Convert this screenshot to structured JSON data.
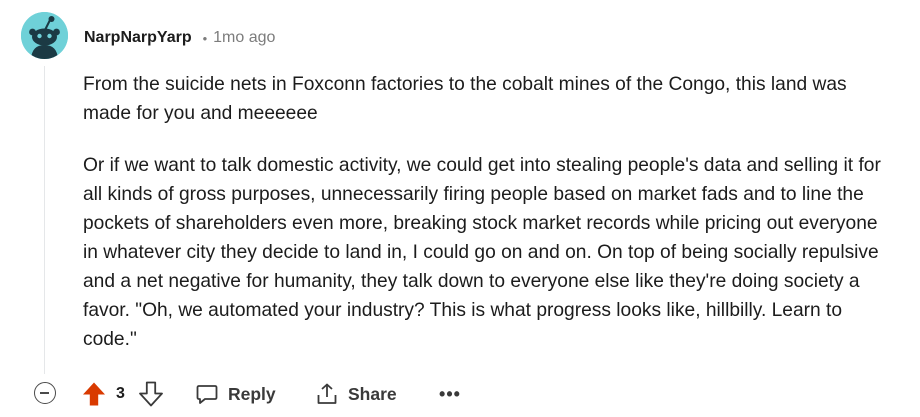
{
  "comment": {
    "author": "NarpNarpYarp",
    "separator": "•",
    "timestamp": "1mo ago",
    "paragraphs": [
      "From the suicide nets in Foxconn factories to the cobalt mines of the Congo, this land was made for you and meeeeee",
      "Or if we want to talk domestic activity, we could get into stealing people's data and selling it for all kinds of gross purposes, unnecessarily firing people based on market fads and to line the pockets of shareholders even more, breaking stock market records while pricing out everyone in whatever city they decide to land in, I could go on and on. On top of being socially repulsive and a net negative for humanity, they talk down to everyone else like they're doing society a favor. \"Oh, we automated your industry? This is what progress looks like, hillbilly. Learn to code.\""
    ],
    "score": "3",
    "upvoted": true
  },
  "actions": {
    "reply_label": "Reply",
    "share_label": "Share",
    "more_label": "•••"
  },
  "icons": {
    "avatar": "snoo-avatar-icon",
    "collapse": "collapse-minus-icon",
    "upvote": "upvote-arrow-icon",
    "downvote": "downvote-arrow-icon",
    "reply": "comment-bubble-icon",
    "share": "share-icon",
    "more": "more-dots-icon"
  },
  "colors": {
    "upvote_active": "#d93a00",
    "avatar_bg": "#6fd1d8",
    "muted_text": "#7c7c7c",
    "text": "#1c1c1c"
  }
}
